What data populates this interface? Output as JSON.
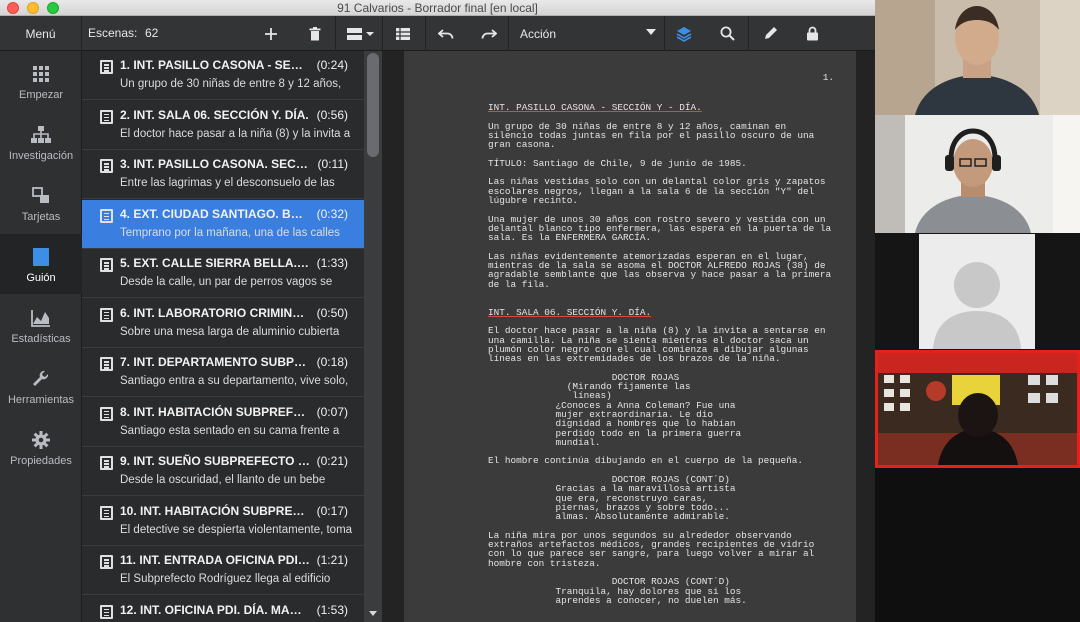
{
  "window": {
    "title": "91 Calvarios - Borrador final [en local]"
  },
  "toolbar": {
    "menu_label": "Menú",
    "scenes_label": "Escenas:",
    "scenes_count": "62",
    "action_value": "Acción"
  },
  "sidebar": {
    "items": [
      {
        "label": "Empezar",
        "icon": "grid-icon"
      },
      {
        "label": "Investigación",
        "icon": "hierarchy-icon"
      },
      {
        "label": "Tarjetas",
        "icon": "cards-icon"
      },
      {
        "label": "Guión",
        "icon": "script-icon"
      },
      {
        "label": "Estadísticas",
        "icon": "chart-icon"
      },
      {
        "label": "Herramientas",
        "icon": "wrench-icon"
      },
      {
        "label": "Propiedades",
        "icon": "gear-icon"
      }
    ]
  },
  "scenes": [
    {
      "title": "1. INT. PASILLO CASONA - SECCI…",
      "time": "(0:24)",
      "summary": "Un grupo de 30 niñas de entre 8 y 12 años,"
    },
    {
      "title": "2. INT. SALA 06. SECCIÓN Y. DÍA.",
      "time": "(0:56)",
      "summary": "El doctor hace pasar a la niña (8) y la invita a"
    },
    {
      "title": "3. INT. PASILLO CASONA. SECCIÓ…",
      "time": "(0:11)",
      "summary": "Entre las lagrimas y el desconsuelo de las"
    },
    {
      "title": "4. EXT. CIUDAD SANTIAGO. BARRI…",
      "time": "(0:32)",
      "summary": "Temprano por la mañana, una de las calles"
    },
    {
      "title": "5. EXT. CALLE SIERRA BELLA. BAR…",
      "time": "(1:33)",
      "summary": "Desde la calle, un par de perros vagos se"
    },
    {
      "title": "6. INT. LABORATORIO CRIMINALÍ…",
      "time": "(0:50)",
      "summary": "Sobre una mesa larga de aluminio cubierta"
    },
    {
      "title": "7. INT. DEPARTAMENTO SUBPREF…",
      "time": "(0:18)",
      "summary": "Santiago entra a su departamento, vive solo,"
    },
    {
      "title": "8. INT. HABITACIÓN SUBPREFECT…",
      "time": "(0:07)",
      "summary": "Santiago esta sentado en su cama frente a"
    },
    {
      "title": "9. INT. SUEÑO SUBPREFECTO ROD…",
      "time": "(0:21)",
      "summary": "Desde la oscuridad, el llanto de un bebe"
    },
    {
      "title": "10. INT. HABITACIÓN SUBPREFEC…",
      "time": "(0:17)",
      "summary": "El detective se despierta violentamente, toma"
    },
    {
      "title": "11. INT. ENTRADA OFICINA PDI. D…",
      "time": "(1:21)",
      "summary": "El Subprefecto Rodríguez llega al edificio"
    },
    {
      "title": "12. INT. OFICINA PDI. DÍA. MAÑA…",
      "time": "(1:53)",
      "summary": ""
    }
  ],
  "script": {
    "page_number": "1.",
    "lines": [
      "INT. PASILLO CASONA - SECCIÓN Y - DÍA.",
      "",
      "Un grupo de 30 niñas de entre 8 y 12 años, caminan en",
      "silencio todas juntas en fila por el pasillo oscuro de una",
      "gran casona.",
      "",
      "TÍTULO: Santiago de Chile, 9 de junio de 1985.",
      "",
      "Las niñas vestidas solo con un delantal color gris y zapatos",
      "escolares negros, llegan a la sala 6 de la sección \"Y\" del",
      "lúgubre recinto.",
      "",
      "Una mujer de unos 30 años con rostro severo y vestida con un",
      "delantal blanco tipo enfermera, las espera en la puerta de la",
      "sala. Es la ENFERMERA GARCÍA.",
      "",
      "Las niñas evidentemente atemorizadas esperan en el lugar,",
      "mientras de la sala se asoma el DOCTOR ALFREDO ROJAS (38) de",
      "agradable semblante que las observa y hace pasar a la primera",
      "de la fila.",
      "",
      "",
      "INT. SALA 06. SECCIÓN Y. DÍA.",
      "",
      "El doctor hace pasar a la niña (8) y la invita a sentarse en",
      "una camilla. La niña se sienta mientras el doctor saca un",
      "plumón color negro con el cual comienza a dibujar algunas",
      "líneas en las extremidades de los brazos de la niña.",
      "",
      "                      DOCTOR ROJAS",
      "              (Mirando fijamente las",
      "               líneas)",
      "            ¿Conoces a Anna Coleman? Fue una",
      "            mujer extraordinaria. Le dio",
      "            dignidad a hombres que lo habían",
      "            perdido todo en la primera guerra",
      "            mundial.",
      "",
      "El hombre continúa dibujando en el cuerpo de la pequeña.",
      "",
      "                      DOCTOR ROJAS (CONT´D)",
      "            Gracias a la maravillosa artista",
      "            que era, reconstruyo caras,",
      "            piernas, brazos y sobre todo...",
      "            almas. Absolutamente admirable.",
      "",
      "La niña mira por unos segundos su alrededor observando",
      "extraños artefactos médicos, grandes recipientes de vidrio",
      "con lo que parece ser sangre, para luego volver a mirar al",
      "hombre con tristeza.",
      "",
      "                      DOCTOR ROJAS (CONT´D)",
      "            Tranquila, hay dolores que si los",
      "            aprendes a conocer, no duelen más."
    ]
  },
  "colors": {
    "selected_scene": "#3a7fe0",
    "active_sidebar_icon": "#3d8fe6",
    "active_speaker_border": "#e8201a"
  }
}
